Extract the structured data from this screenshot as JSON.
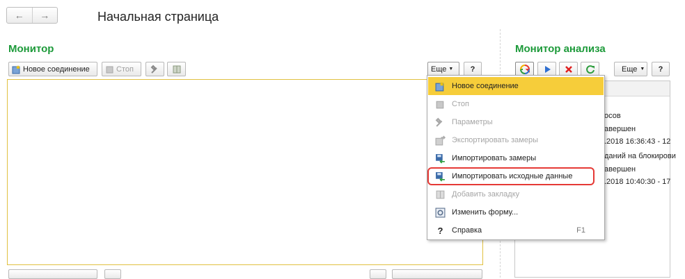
{
  "nav": {
    "back_icon": "arrow-left-icon",
    "forward_icon": "arrow-right-icon"
  },
  "page_title": "Начальная страница",
  "monitor": {
    "title": "Монитор",
    "buttons": {
      "new_connection": "Новое соединение",
      "stop": "Стоп",
      "more": "Еще",
      "help": "?"
    }
  },
  "analysis": {
    "title": "Монитор анализа",
    "buttons": {
      "more": "Еще",
      "help": "?"
    },
    "rows": [
      "осов",
      "авершен",
      ".2018 16:36:43 - 12",
      "даний на блокирови",
      "авершен",
      ".2018 10:40:30 - 17"
    ]
  },
  "menu": {
    "items": [
      {
        "label": "Новое соединение",
        "icon": "new-connection-icon",
        "state": "highlighted"
      },
      {
        "label": "Стоп",
        "icon": "stop-icon",
        "state": "disabled"
      },
      {
        "label": "Параметры",
        "icon": "tools-icon",
        "state": "disabled"
      },
      {
        "label": "Экспортировать замеры",
        "icon": "export-icon",
        "state": "disabled"
      },
      {
        "label": "Импортировать замеры",
        "icon": "import-icon",
        "state": "enabled"
      },
      {
        "label": "Импортировать исходные данные",
        "icon": "import-source-icon",
        "state": "enabled"
      },
      {
        "label": "Добавить закладку",
        "icon": "bookmark-icon",
        "state": "disabled"
      },
      {
        "label": "Изменить форму...",
        "icon": "form-icon",
        "state": "enabled"
      },
      {
        "label": "Справка",
        "icon": "help-icon",
        "state": "enabled",
        "shortcut": "F1"
      }
    ]
  },
  "colors": {
    "title_green": "#1d9a3a",
    "highlight": "#f6cd3a",
    "annotation_red": "#e53935"
  }
}
